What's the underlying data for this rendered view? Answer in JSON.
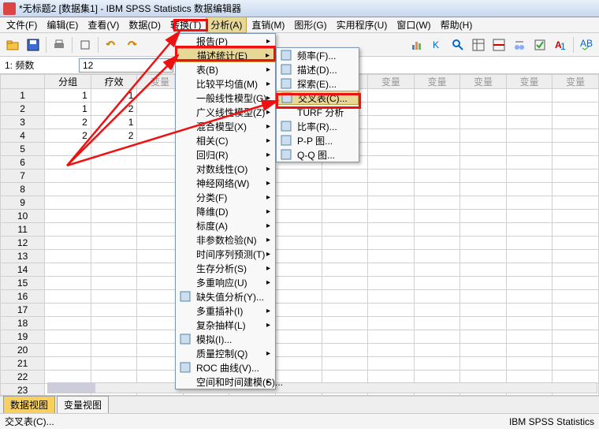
{
  "title": "*无标题2 [数据集1] - IBM SPSS Statistics 数据编辑器",
  "menubar": [
    "文件(F)",
    "编辑(E)",
    "查看(V)",
    "数据(D)",
    "转换(T)",
    "分析(A)",
    "直销(M)",
    "图形(G)",
    "实用程序(U)",
    "窗口(W)",
    "帮助(H)"
  ],
  "menubar_active_index": 5,
  "inputrow": {
    "label": "1: 频数",
    "value": "12"
  },
  "columns": [
    "分组",
    "疗效",
    "变量",
    "变量",
    "变量",
    "变量",
    "变量",
    "变量",
    "变量",
    "变量",
    "变量",
    "变量"
  ],
  "rows": [
    {
      "n": 1,
      "c": [
        1,
        1
      ]
    },
    {
      "n": 2,
      "c": [
        1,
        2
      ]
    },
    {
      "n": 3,
      "c": [
        2,
        1
      ]
    },
    {
      "n": 4,
      "c": [
        2,
        2
      ]
    },
    {
      "n": 5
    },
    {
      "n": 6
    },
    {
      "n": 7
    },
    {
      "n": 8
    },
    {
      "n": 9
    },
    {
      "n": 10
    },
    {
      "n": 11
    },
    {
      "n": 12
    },
    {
      "n": 13
    },
    {
      "n": 14
    },
    {
      "n": 15
    },
    {
      "n": 16
    },
    {
      "n": 17
    },
    {
      "n": 18
    },
    {
      "n": 19
    },
    {
      "n": 20
    },
    {
      "n": 21
    },
    {
      "n": 22
    },
    {
      "n": 23
    }
  ],
  "menu_analyze": [
    {
      "label": "报告(P)",
      "sub": true
    },
    {
      "label": "描述统计(E)",
      "sub": true,
      "hl": true
    },
    {
      "label": "表(B)",
      "sub": true
    },
    {
      "label": "比较平均值(M)",
      "sub": true
    },
    {
      "label": "一般线性模型(G)",
      "sub": true
    },
    {
      "label": "广义线性模型(Z)",
      "sub": true
    },
    {
      "label": "混合模型(X)",
      "sub": true
    },
    {
      "label": "相关(C)",
      "sub": true
    },
    {
      "label": "回归(R)",
      "sub": true
    },
    {
      "label": "对数线性(O)",
      "sub": true
    },
    {
      "label": "神经网络(W)",
      "sub": true
    },
    {
      "label": "分类(F)",
      "sub": true
    },
    {
      "label": "降维(D)",
      "sub": true
    },
    {
      "label": "标度(A)",
      "sub": true
    },
    {
      "label": "非参数检验(N)",
      "sub": true
    },
    {
      "label": "时间序列预测(T)",
      "sub": true
    },
    {
      "label": "生存分析(S)",
      "sub": true
    },
    {
      "label": "多重响应(U)",
      "sub": true
    },
    {
      "label": "缺失值分析(Y)...",
      "icon": "chart"
    },
    {
      "label": "多重插补(I)",
      "sub": true
    },
    {
      "label": "复杂抽样(L)",
      "sub": true
    },
    {
      "label": "模拟(I)...",
      "icon": "sim"
    },
    {
      "label": "质量控制(Q)",
      "sub": true
    },
    {
      "label": "ROC 曲线(V)...",
      "icon": "roc"
    },
    {
      "label": "空间和时间建模(S)...",
      "sub": true
    }
  ],
  "menu_descriptives": [
    {
      "label": "频率(F)...",
      "icon": "freq"
    },
    {
      "label": "描述(D)...",
      "icon": "desc"
    },
    {
      "label": "探索(E)...",
      "icon": "expl"
    },
    {
      "label": "交叉表(C)...",
      "icon": "cross",
      "hl": true
    },
    {
      "label": "TURF 分析"
    },
    {
      "label": "比率(R)...",
      "icon": "ratio"
    },
    {
      "label": "P-P 图...",
      "icon": "pp"
    },
    {
      "label": "Q-Q 图...",
      "icon": "qq"
    }
  ],
  "tabs": [
    "数据视图",
    "变量视图"
  ],
  "tabs_active": 0,
  "status_left": "交叉表(C)...",
  "status_right": "IBM SPSS Statistics"
}
